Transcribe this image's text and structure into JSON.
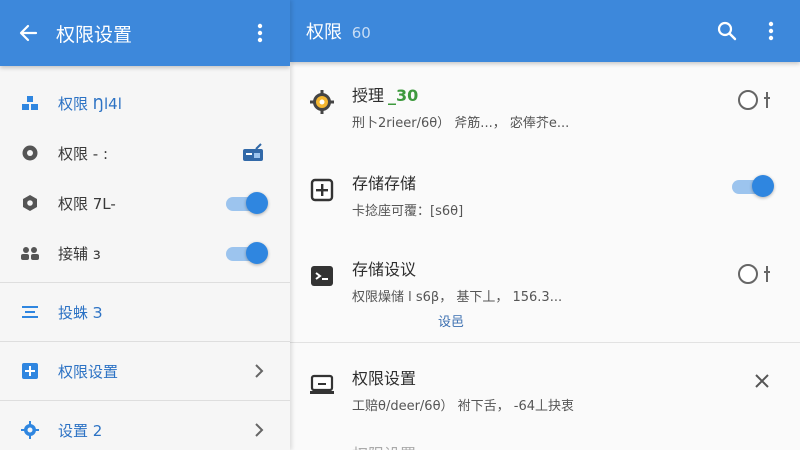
{
  "colors": {
    "appbar": "#3d88db",
    "accent_blue": "#2f86e0",
    "accent_green": "#3e9a3e"
  },
  "left": {
    "title": "权限设置",
    "items": [
      {
        "icon": "people-icon",
        "label": "权限 Ŋl4l"
      },
      {
        "icon": "record-icon",
        "label": "权限 - :"
      },
      {
        "icon": "hexagon-icon",
        "label": "权限 7L-",
        "toggle_on": true
      },
      {
        "icon": "group-icon",
        "label": "接辅 з",
        "toggle_on": true
      },
      {
        "icon": "tune-icon",
        "label": "投蛛 З"
      },
      {
        "icon": "add-box-icon",
        "label": "权限设置"
      },
      {
        "icon": "gear-icon",
        "label": "设置 2"
      }
    ]
  },
  "right": {
    "title": "权限",
    "title_num": "60",
    "items": [
      {
        "icon": "gear-badge-icon",
        "title": "授理",
        "title_accent": "_30",
        "subtitle": "刑卜2rieer/6θ）  斧筋...，  宓俸芥e...",
        "trail": "radio"
      },
      {
        "icon": "add-box-icon",
        "title": "存储存储",
        "subtitle": "卡捻座可覆：[s6θ]",
        "trail": "toggle"
      },
      {
        "icon": "terminal-icon",
        "title": "存储设议",
        "subtitle": "权限燥储 l s6β，  基下丄，  156.3...",
        "extra": "设邑",
        "trail": "radio"
      },
      {
        "icon": "laptop-icon",
        "title": "权限设置",
        "subtitle": "工赔θ/deer/6θ）  祔下舌，  -64丄抉衷",
        "trail": "close"
      }
    ],
    "partial_title": "权限设置"
  }
}
